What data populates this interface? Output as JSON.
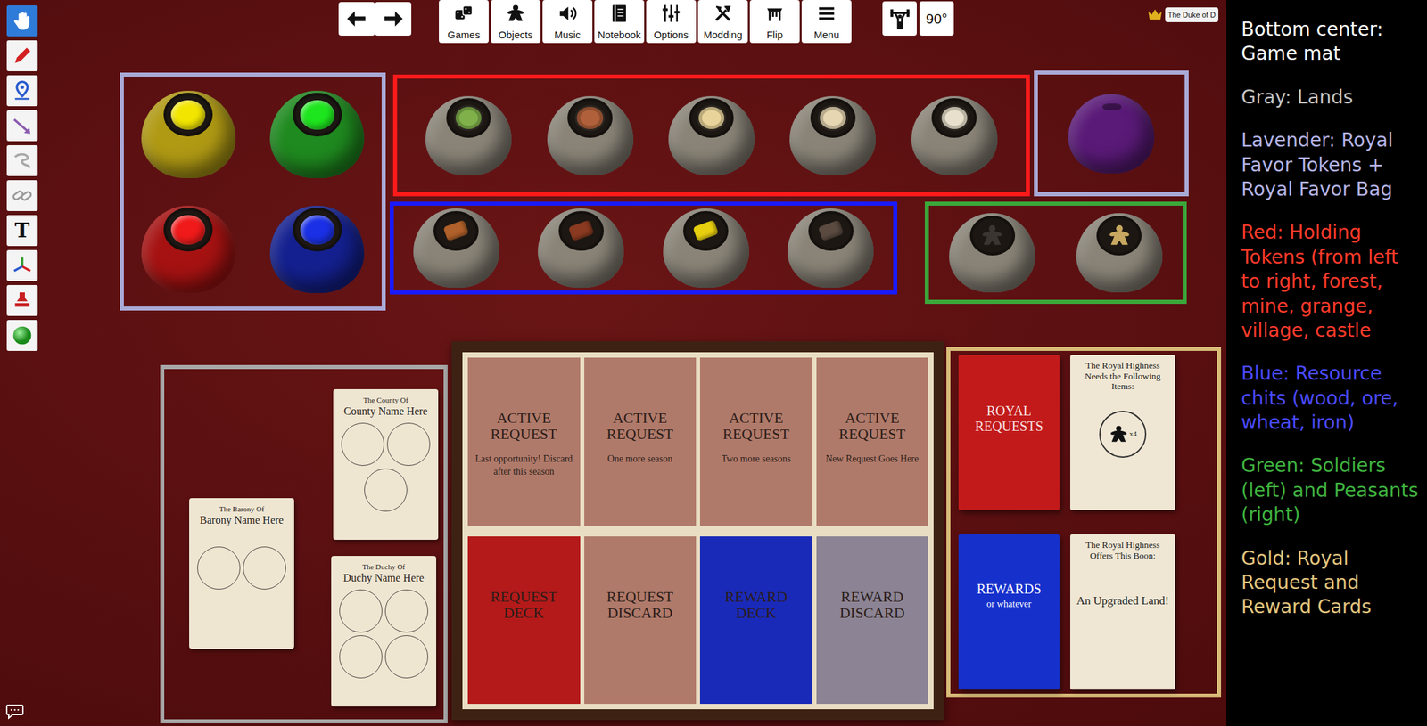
{
  "toolbar": {
    "tools": [
      {
        "selected": true
      },
      {
        "selected": false
      },
      {
        "selected": false
      },
      {
        "selected": false
      },
      {
        "selected": false
      },
      {
        "selected": false
      },
      {
        "selected": false,
        "glyph": "T"
      },
      {
        "selected": false
      },
      {
        "selected": false
      },
      {
        "selected": false
      }
    ]
  },
  "nav": {
    "buttons": [
      {
        "label": "Games"
      },
      {
        "label": "Objects"
      },
      {
        "label": "Music"
      },
      {
        "label": "Notebook"
      },
      {
        "label": "Options"
      },
      {
        "label": "Modding"
      },
      {
        "label": "Flip"
      },
      {
        "label": "Menu"
      }
    ]
  },
  "rotation": {
    "label": "90°"
  },
  "player": {
    "name": "The Duke of D"
  },
  "legend": [
    {
      "text": "Bottom center: Game mat",
      "color": "#ffffff"
    },
    {
      "text": "Gray: Lands",
      "color": "#c4c4c4"
    },
    {
      "text": "Lavender: Royal Favor Tokens + Royal Favor Bag",
      "color": "#b4b4e6"
    },
    {
      "text": "Red: Holding Tokens (from left to right, forest, mine, grange, village, castle",
      "color": "#ff3a2a"
    },
    {
      "text": "Blue: Resource chits (wood, ore, wheat, iron)",
      "color": "#4a4aff"
    },
    {
      "text": "Green: Soldiers (left) and Peasants (right)",
      "color": "#3fb43f"
    },
    {
      "text": "Gold: Royal Request and Reward Cards",
      "color": "#e2c47e"
    }
  ],
  "bag_groups": [
    {
      "color": "#a9a9d6",
      "bags": [
        {
          "color": "#b09a14",
          "kind": "disc",
          "token": "#f2e600"
        },
        {
          "color": "#1f8a1f",
          "kind": "disc",
          "token": "#1ee61e"
        },
        {
          "color": "#a61212",
          "kind": "disc",
          "token": "#f01a1a"
        },
        {
          "color": "#14208f",
          "kind": "disc",
          "token": "#1a30e6"
        }
      ]
    },
    {
      "color": "#ff1a1a",
      "bags": [
        {
          "color": "#8a8478",
          "kind": "emblem",
          "token": "#7fb04a"
        },
        {
          "color": "#8a8478",
          "kind": "emblem",
          "token": "#b0603a"
        },
        {
          "color": "#8a8478",
          "kind": "emblem",
          "token": "#e8d49a"
        },
        {
          "color": "#8a8478",
          "kind": "emblem",
          "token": "#e6d6b2"
        },
        {
          "color": "#8a8478",
          "kind": "emblem",
          "token": "#e8e0cc"
        }
      ]
    },
    {
      "color": "#a9a9d6",
      "bags": [
        {
          "color": "#5a1a78",
          "kind": "none",
          "token": "#5a1a78"
        }
      ]
    },
    {
      "color": "#1a1aff",
      "bags": [
        {
          "color": "#8a8478",
          "kind": "chit",
          "token": "#b0602a"
        },
        {
          "color": "#8a8478",
          "kind": "chit",
          "token": "#8a3a20"
        },
        {
          "color": "#8a8478",
          "kind": "chit",
          "token": "#e8d010"
        },
        {
          "color": "#8a8478",
          "kind": "chit",
          "token": "#5a4a40"
        }
      ]
    },
    {
      "color": "#3aa83a",
      "bags": [
        {
          "color": "#8a8478",
          "kind": "meeple",
          "token": "#3a3530"
        },
        {
          "color": "#8a8478",
          "kind": "meeple",
          "token": "#c8a860"
        }
      ]
    }
  ],
  "lands": {
    "color": "#a8a8a8",
    "cards": [
      {
        "title": "The Barony Of",
        "name": "Barony Name Here",
        "slots": 2
      },
      {
        "title": "The County Of",
        "name": "County Name Here",
        "slots": 3
      },
      {
        "title": "The Duchy Of",
        "name": "Duchy Name Here",
        "slots": 4
      }
    ]
  },
  "mat": {
    "slots": [
      {
        "title": "ACTIVE REQUEST",
        "note": "Last opportunity! Discard after this season",
        "color": "#b07a6a"
      },
      {
        "title": "ACTIVE REQUEST",
        "note": "One more season",
        "color": "#b07a6a"
      },
      {
        "title": "ACTIVE REQUEST",
        "note": "Two more seasons",
        "color": "#b07a6a"
      },
      {
        "title": "ACTIVE REQUEST",
        "note": "New Request Goes Here",
        "color": "#b07a6a"
      },
      {
        "title": "REQUEST DECK",
        "color": "#b41a1a"
      },
      {
        "title": "REQUEST DISCARD",
        "color": "#b07a6a"
      },
      {
        "title": "REWARD DECK",
        "color": "#1a2ab8"
      },
      {
        "title": "REWARD DISCARD",
        "color": "#8c8494"
      }
    ]
  },
  "royal": {
    "color": "#d8bc78",
    "request_deck": {
      "title": "ROYAL REQUESTS"
    },
    "request": {
      "header": "The Royal Highness Needs the Following Items:",
      "count": "x4"
    },
    "reward_deck": {
      "title": "REWARDS",
      "note": "or whatever"
    },
    "reward": {
      "header": "The Royal Highness Offers This Boon:",
      "text": "An Upgraded Land!"
    }
  }
}
